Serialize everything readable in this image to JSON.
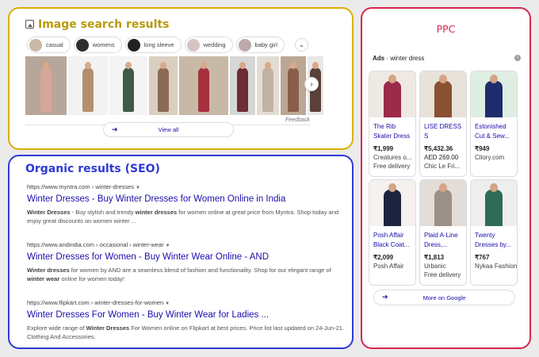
{
  "image_panel": {
    "title": "Image search results",
    "chips": [
      {
        "label": "casual",
        "color": "#c9b8a6"
      },
      {
        "label": "womens",
        "color": "#2e2e2e"
      },
      {
        "label": "long sleeve",
        "color": "#222222"
      },
      {
        "label": "wedding",
        "color": "#d4c4c4"
      },
      {
        "label": "baby girl",
        "color": "#bda9a9"
      }
    ],
    "photos": [
      {
        "bg": "#b7a79a",
        "dress": "#d8a69b",
        "w": 52
      },
      {
        "bg": "#f2f2f2",
        "dress": "#b48f6e",
        "w": 50
      },
      {
        "bg": "#f4f4f4",
        "dress": "#3f5b48",
        "w": 48
      },
      {
        "bg": "#d9cfc0",
        "dress": "#8b6a55",
        "w": 36
      },
      {
        "bg": "#c8b9a6",
        "dress": "#a7303d",
        "w": 62
      },
      {
        "bg": "#d6d6d6",
        "dress": "#6f2b36",
        "w": 32
      },
      {
        "bg": "#e3dcd2",
        "dress": "#c1b3a3",
        "w": 28
      },
      {
        "bg": "#bca795",
        "dress": "#8a5f4a",
        "w": 32
      },
      {
        "bg": "#e8e8e8",
        "dress": "#5a4038",
        "w": 20
      }
    ],
    "feedback": "Feedback",
    "view_all": "View all"
  },
  "organic_panel": {
    "title": "Organic results (SEO)",
    "results": [
      {
        "url": "https://www.myntra.com › winter-dresses",
        "title": "Winter Dresses - Buy Winter Dresses for Women Online in India",
        "snippet_html": "<b>Winter Dresses</b> - Buy stylish and trendy <b>winter dresses</b> for women online at great price from Myntra. Shop today and enjoy great discounts on women winter ..."
      },
      {
        "url": "https://www.andindia.com › occasional › winter-wear",
        "title": "Winter Dresses for Women - Buy Winter Wear Online - AND",
        "snippet_html": "<b>Winter dresses</b> for women by AND are a seamless blend of fashion and functionality. Shop for our elegant range of <b>winter wear</b> online for women today!"
      },
      {
        "url": "https://www.flipkart.com › winter-dresses-for-women",
        "title": "Winter Dresses For Women - Buy Winter Wear for Ladies ...",
        "snippet_html": "Explore wide range of <b>Winter Dresses</b> For Women online on Flipkart at best prices. Price list last updated on 24-Jun-21. Clothing And Accessories."
      }
    ]
  },
  "ppc_panel": {
    "title": "PPC",
    "ads_label": "Ads",
    "ads_query": "winter dress",
    "info": "i",
    "cards": [
      {
        "title": "The Rib Skater Dress",
        "price": "₹1,999",
        "price2": "",
        "seller": "Creatures o...",
        "delivery": "Free delivery",
        "bg": "#efe9e4",
        "dress": "#9c2a4a"
      },
      {
        "title": "LISE DRESS S",
        "price": "₹5,432.36",
        "price2": "AED 269.00",
        "seller": "Chic Le Fri...",
        "delivery": "",
        "bg": "#e8e2da",
        "dress": "#8a5132"
      },
      {
        "title": "Estonished Cut & Sew...",
        "price": "₹949",
        "price2": "",
        "seller": "Cilory.com",
        "delivery": "",
        "bg": "#dfeee3",
        "dress": "#1f2d6e"
      },
      {
        "title": "Posh Affair Black Coat...",
        "price": "₹2,099",
        "price2": "",
        "seller": "Posh Affair",
        "delivery": "",
        "bg": "#f4f1ee",
        "dress": "#1d2440"
      },
      {
        "title": "Plaid A-Line Dress,...",
        "price": "₹1,813",
        "price2": "",
        "seller": "Urbanic",
        "delivery": "Free delivery",
        "bg": "#e2ddd8",
        "dress": "#9b8f86"
      },
      {
        "title": "Twenty Dresses by...",
        "price": "₹767",
        "price2": "",
        "seller": "Nykaa Fashion",
        "delivery": "",
        "bg": "#eeeeee",
        "dress": "#2f6b58"
      }
    ],
    "more": "More on Google"
  }
}
